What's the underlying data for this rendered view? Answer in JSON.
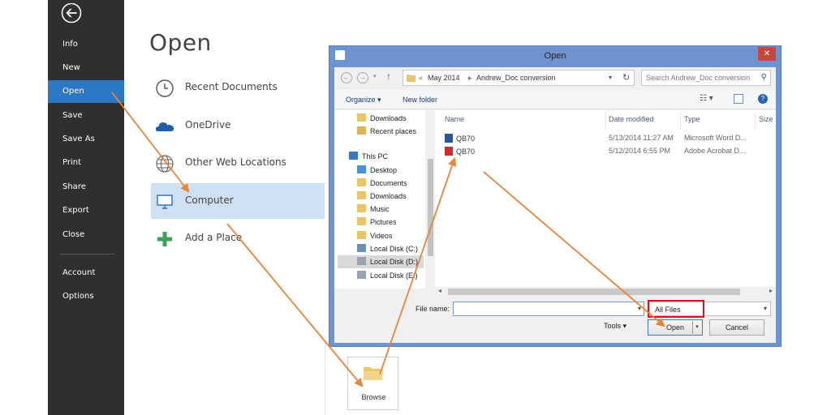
{
  "colors": {
    "sidebar_bg": "#2f2f2f",
    "sidebar_active": "#2b78c5",
    "place_selected": "#cfe0f3",
    "dialog_frame": "#6d93d1",
    "close_red": "#c9463d",
    "arrow": "#e8833a",
    "highlight_red": "#d0191d"
  },
  "sidebar": {
    "back_icon": "back-arrow-icon",
    "items": [
      {
        "label": "Info"
      },
      {
        "label": "New"
      },
      {
        "label": "Open",
        "active": true
      },
      {
        "label": "Save"
      },
      {
        "label": "Save As"
      },
      {
        "label": "Print"
      },
      {
        "label": "Share"
      },
      {
        "label": "Export"
      },
      {
        "label": "Close"
      }
    ],
    "bottom_items": [
      {
        "label": "Account"
      },
      {
        "label": "Options"
      }
    ]
  },
  "open_pane": {
    "title": "Open",
    "places": [
      {
        "label": "Recent Documents",
        "icon": "clock-icon"
      },
      {
        "label": "OneDrive",
        "icon": "cloud-icon"
      },
      {
        "label": "Other Web Locations",
        "icon": "globe-icon"
      },
      {
        "label": "Computer",
        "icon": "computer-icon",
        "selected": true
      },
      {
        "label": "Add a Place",
        "icon": "plus-icon"
      }
    ],
    "browse_label": "Browse"
  },
  "dialog": {
    "title": "Open",
    "close_glyph": "✕",
    "address": {
      "prefix": "«",
      "crumbs": [
        "May 2014",
        "Andrew_Doc conversion"
      ]
    },
    "search_placeholder": "Search Andrew_Doc conversion",
    "toolbar": {
      "organize": "Organize ▾",
      "new_folder": "New folder"
    },
    "nav_items": [
      {
        "label": "Downloads",
        "icon": "folder-icon"
      },
      {
        "label": "Recent places",
        "icon": "recent-places-icon"
      },
      {
        "label": "This PC",
        "icon": "pc-icon"
      },
      {
        "label": "Desktop",
        "icon": "folder-icon"
      },
      {
        "label": "Documents",
        "icon": "folder-icon"
      },
      {
        "label": "Downloads",
        "icon": "folder-icon"
      },
      {
        "label": "Music",
        "icon": "folder-icon"
      },
      {
        "label": "Pictures",
        "icon": "folder-icon"
      },
      {
        "label": "Videos",
        "icon": "folder-icon"
      },
      {
        "label": "Local Disk (C:)",
        "icon": "drive-icon"
      },
      {
        "label": "Local Disk (D:)",
        "icon": "drive-icon",
        "selected": true
      },
      {
        "label": "Local Disk (E:)",
        "icon": "drive-icon"
      }
    ],
    "columns": [
      "Name",
      "Date modified",
      "Type",
      "Size"
    ],
    "files": [
      {
        "name": "QB70",
        "date": "5/13/2014 11:27 AM",
        "type": "Microsoft Word D...",
        "icon": "word-file-icon"
      },
      {
        "name": "QB70",
        "date": "5/12/2014 6:55 PM",
        "type": "Adobe Acrobat D...",
        "icon": "pdf-file-icon"
      }
    ],
    "file_name_label": "File name:",
    "file_name_value": "",
    "filter_value": "All Files",
    "tools_label": "Tools ▾",
    "open_label": "Open",
    "cancel_label": "Cancel"
  }
}
